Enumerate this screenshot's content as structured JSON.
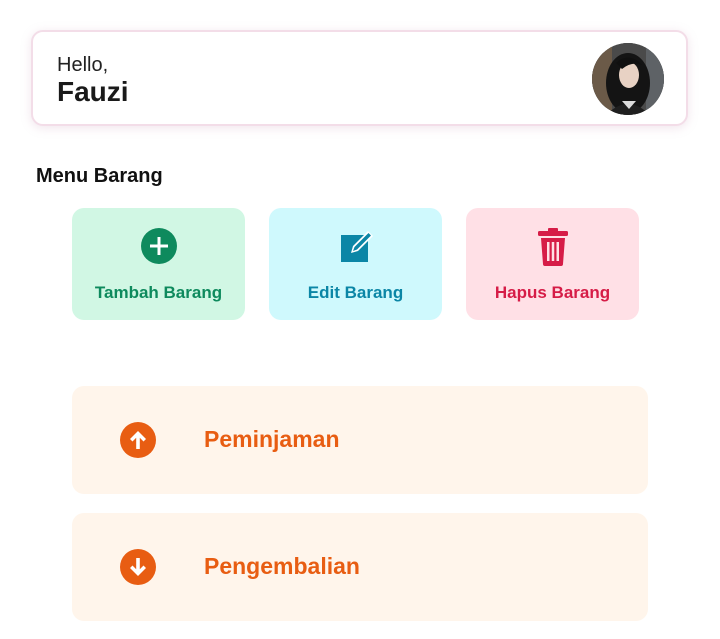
{
  "header": {
    "greeting": "Hello,",
    "user_name": "Fauzi",
    "avatar_icon": "user-avatar-photo"
  },
  "menu": {
    "title": "Menu Barang",
    "actions": [
      {
        "label": "Tambah Barang",
        "icon": "plus-circle-icon",
        "color": "#0e8a5d",
        "background": "#d1f7e4"
      },
      {
        "label": "Edit Barang",
        "icon": "edit-icon",
        "color": "#0b86a6",
        "background": "#cff9fd"
      },
      {
        "label": "Hapus Barang",
        "icon": "trash-icon",
        "color": "#d61c47",
        "background": "#ffe0e6"
      }
    ]
  },
  "transactions": [
    {
      "label": "Peminjaman",
      "icon": "arrow-up-circle-icon",
      "color": "#e85d12",
      "background": "#fff5eb"
    },
    {
      "label": "Pengembalian",
      "icon": "arrow-down-circle-icon",
      "color": "#e85d12",
      "background": "#fff5eb"
    }
  ]
}
